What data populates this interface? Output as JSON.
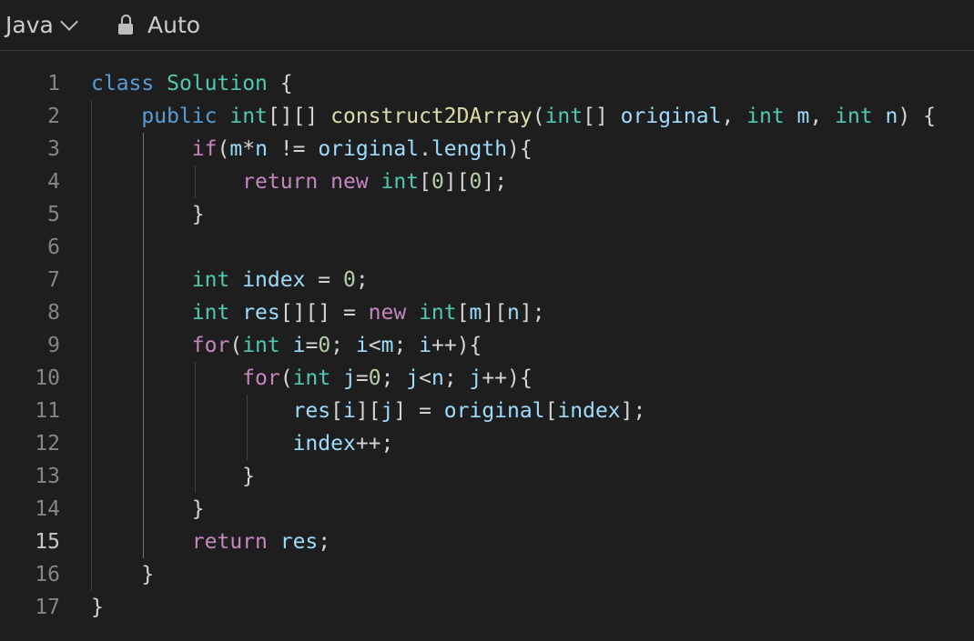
{
  "toolbar": {
    "language": "Java",
    "language_icon": "chevron-down-icon",
    "mode_icon": "lock-icon",
    "mode": "Auto"
  },
  "editor": {
    "active_line": 15,
    "lines": [
      {
        "num": "1",
        "tokens": [
          [
            "class",
            "kw"
          ],
          [
            " ",
            "pun"
          ],
          [
            "Solution",
            "ty"
          ],
          [
            " {",
            "pun"
          ]
        ]
      },
      {
        "num": "2",
        "tokens": [
          [
            "    ",
            "pun"
          ],
          [
            "public",
            "kw"
          ],
          [
            " ",
            "pun"
          ],
          [
            "int",
            "ty"
          ],
          [
            "[][] ",
            "pun"
          ],
          [
            "construct2DArray",
            "fn"
          ],
          [
            "(",
            "pun"
          ],
          [
            "int",
            "ty"
          ],
          [
            "[] ",
            "pun"
          ],
          [
            "original",
            "var"
          ],
          [
            ", ",
            "pun"
          ],
          [
            "int",
            "ty"
          ],
          [
            " ",
            "pun"
          ],
          [
            "m",
            "var"
          ],
          [
            ", ",
            "pun"
          ],
          [
            "int",
            "ty"
          ],
          [
            " ",
            "pun"
          ],
          [
            "n",
            "var"
          ],
          [
            ") {",
            "pun"
          ]
        ]
      },
      {
        "num": "3",
        "tokens": [
          [
            "        ",
            "pun"
          ],
          [
            "if",
            "ctl"
          ],
          [
            "(",
            "pun"
          ],
          [
            "m",
            "var"
          ],
          [
            "*",
            "pun"
          ],
          [
            "n",
            "var"
          ],
          [
            " != ",
            "pun"
          ],
          [
            "original",
            "var"
          ],
          [
            ".",
            "pun"
          ],
          [
            "length",
            "var"
          ],
          [
            "){",
            "pun"
          ]
        ]
      },
      {
        "num": "4",
        "tokens": [
          [
            "            ",
            "pun"
          ],
          [
            "return",
            "ctl"
          ],
          [
            " ",
            "pun"
          ],
          [
            "new",
            "ctl"
          ],
          [
            " ",
            "pun"
          ],
          [
            "int",
            "ty"
          ],
          [
            "[",
            "pun"
          ],
          [
            "0",
            "num"
          ],
          [
            "][",
            "pun"
          ],
          [
            "0",
            "num"
          ],
          [
            "];",
            "pun"
          ]
        ]
      },
      {
        "num": "5",
        "tokens": [
          [
            "        }",
            "pun"
          ]
        ]
      },
      {
        "num": "6",
        "tokens": []
      },
      {
        "num": "7",
        "tokens": [
          [
            "        ",
            "pun"
          ],
          [
            "int",
            "ty"
          ],
          [
            " ",
            "pun"
          ],
          [
            "index",
            "var"
          ],
          [
            " = ",
            "pun"
          ],
          [
            "0",
            "num"
          ],
          [
            ";",
            "pun"
          ]
        ]
      },
      {
        "num": "8",
        "tokens": [
          [
            "        ",
            "pun"
          ],
          [
            "int",
            "ty"
          ],
          [
            " ",
            "pun"
          ],
          [
            "res",
            "var"
          ],
          [
            "[][] = ",
            "pun"
          ],
          [
            "new",
            "ctl"
          ],
          [
            " ",
            "pun"
          ],
          [
            "int",
            "ty"
          ],
          [
            "[",
            "pun"
          ],
          [
            "m",
            "var"
          ],
          [
            "][",
            "pun"
          ],
          [
            "n",
            "var"
          ],
          [
            "];",
            "pun"
          ]
        ]
      },
      {
        "num": "9",
        "tokens": [
          [
            "        ",
            "pun"
          ],
          [
            "for",
            "ctl"
          ],
          [
            "(",
            "pun"
          ],
          [
            "int",
            "ty"
          ],
          [
            " ",
            "pun"
          ],
          [
            "i",
            "var"
          ],
          [
            "=",
            "pun"
          ],
          [
            "0",
            "num"
          ],
          [
            "; ",
            "pun"
          ],
          [
            "i",
            "var"
          ],
          [
            "<",
            "pun"
          ],
          [
            "m",
            "var"
          ],
          [
            "; ",
            "pun"
          ],
          [
            "i",
            "var"
          ],
          [
            "++){",
            "pun"
          ]
        ]
      },
      {
        "num": "10",
        "tokens": [
          [
            "            ",
            "pun"
          ],
          [
            "for",
            "ctl"
          ],
          [
            "(",
            "pun"
          ],
          [
            "int",
            "ty"
          ],
          [
            " ",
            "pun"
          ],
          [
            "j",
            "var"
          ],
          [
            "=",
            "pun"
          ],
          [
            "0",
            "num"
          ],
          [
            "; ",
            "pun"
          ],
          [
            "j",
            "var"
          ],
          [
            "<",
            "pun"
          ],
          [
            "n",
            "var"
          ],
          [
            "; ",
            "pun"
          ],
          [
            "j",
            "var"
          ],
          [
            "++){",
            "pun"
          ]
        ]
      },
      {
        "num": "11",
        "tokens": [
          [
            "                ",
            "pun"
          ],
          [
            "res",
            "var"
          ],
          [
            "[",
            "pun"
          ],
          [
            "i",
            "var"
          ],
          [
            "][",
            "pun"
          ],
          [
            "j",
            "var"
          ],
          [
            "] = ",
            "pun"
          ],
          [
            "original",
            "var"
          ],
          [
            "[",
            "pun"
          ],
          [
            "index",
            "var"
          ],
          [
            "];",
            "pun"
          ]
        ]
      },
      {
        "num": "12",
        "tokens": [
          [
            "                ",
            "pun"
          ],
          [
            "index",
            "var"
          ],
          [
            "++;",
            "pun"
          ]
        ]
      },
      {
        "num": "13",
        "tokens": [
          [
            "            }",
            "pun"
          ]
        ]
      },
      {
        "num": "14",
        "tokens": [
          [
            "        }",
            "pun"
          ]
        ]
      },
      {
        "num": "15",
        "tokens": [
          [
            "        ",
            "pun"
          ],
          [
            "return",
            "ctl"
          ],
          [
            " ",
            "pun"
          ],
          [
            "res",
            "var"
          ],
          [
            ";",
            "pun"
          ]
        ]
      },
      {
        "num": "16",
        "tokens": [
          [
            "    }",
            "pun"
          ]
        ]
      },
      {
        "num": "17",
        "tokens": [
          [
            "}",
            "pun"
          ]
        ]
      }
    ]
  }
}
